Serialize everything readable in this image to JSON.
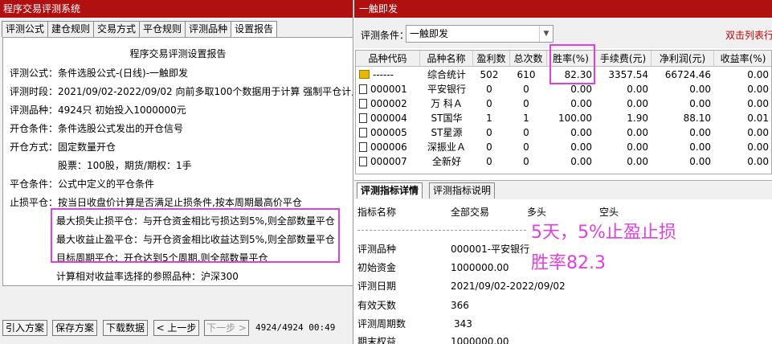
{
  "left": {
    "title": "程序交易评测系统",
    "tabs": [
      "评测公式",
      "建仓规则",
      "交易方式",
      "平仓规则",
      "评测品种",
      "设置报告"
    ],
    "report": {
      "heading": "程序交易评测设置报告",
      "lines": [
        "评测公式：条件选股公式-(日线)-一触即发",
        "评测时段：2021/09/02-2022/09/02 向前多取100个数据用于计算 强制平仓计入",
        "评测品种：4924只 初始投入1000000元",
        "开仓条件：条件选股公式发出的开仓信号",
        "开仓方式：固定数量开仓",
        "股票：100股，期货/期权：1手",
        "平仓条件：公式中定义的平仓条件",
        "止损平仓：按当日收盘价计算是否满足止损条件,按本周期最高价平仓",
        "最大损失止损平仓：与开仓资金相比亏损达到5%,则全部数量平仓",
        "最大收益止盈平仓：与开仓资金相比收益达到5%,则全部数量平仓",
        "目标周期平仓：开仓达到5个周期,则全部数量平仓",
        "计算相对收益率选择的参照品种：沪深300"
      ]
    },
    "buttons": {
      "import": "引入方案",
      "save": "保存方案",
      "download": "下载数据",
      "prev": "< 上一步",
      "next": "下一步 >"
    },
    "status": "4924/4924 00:49"
  },
  "right": {
    "title": "一触即发",
    "filter_label": "评测条件：",
    "filter_value": "一触即发",
    "dblclick_hint": "双击列表行",
    "columns": [
      "品种代码",
      "品种名称",
      "盈利数",
      "总次数",
      "胜率(%)",
      "手续费(元)",
      "净利润(元)",
      "收益率(%)"
    ],
    "rows": [
      {
        "code": "------",
        "name": "综合统计",
        "win": "502",
        "total": "610",
        "rate": "82.30",
        "fee": "3357.54",
        "profit": "66724.46",
        "ret": "0.00",
        "icon": "folder-icon"
      },
      {
        "code": "000001",
        "name": "平安银行",
        "win": "0",
        "total": "0",
        "rate": "0.00",
        "fee": "0.00",
        "profit": "0.00",
        "ret": "0.00",
        "icon": "document-icon"
      },
      {
        "code": "000002",
        "name": "万 科Ａ",
        "win": "0",
        "total": "0",
        "rate": "0.00",
        "fee": "0.00",
        "profit": "0.00",
        "ret": "0.00",
        "icon": "document-icon"
      },
      {
        "code": "000004",
        "name": "ST国华",
        "win": "1",
        "total": "1",
        "rate": "100.00",
        "fee": "1.90",
        "profit": "88.10",
        "ret": "0.01",
        "icon": "document-icon"
      },
      {
        "code": "000005",
        "name": "ST星源",
        "win": "0",
        "total": "0",
        "rate": "0.00",
        "fee": "0.00",
        "profit": "0.00",
        "ret": "0.00",
        "icon": "document-icon"
      },
      {
        "code": "000006",
        "name": "深振业Ａ",
        "win": "0",
        "total": "0",
        "rate": "0.00",
        "fee": "0.00",
        "profit": "0.00",
        "ret": "0.00",
        "icon": "document-icon"
      },
      {
        "code": "000007",
        "name": "全新好",
        "win": "0",
        "total": "0",
        "rate": "0.00",
        "fee": "0.00",
        "profit": "0.00",
        "ret": "0.00",
        "icon": "document-icon"
      }
    ],
    "tabs": [
      "评测指标详情",
      "评测指标说明"
    ],
    "detail_headers": [
      "指标名称",
      "全部交易",
      "多头",
      "空头"
    ],
    "detail_rows": [
      {
        "label": "评测品种",
        "value": "000001-平安银行"
      },
      {
        "label": "初始资金",
        "value": "1000000.00"
      },
      {
        "label": "评测日期",
        "value": "2021/09/02-2022/09/02"
      },
      {
        "label": "有效天数",
        "value": "366"
      },
      {
        "label": "评测周期数",
        "value": "343"
      },
      {
        "label": "期末权益",
        "value": "1000000.00"
      }
    ],
    "annotation_line1": "5天，5%止盈止损",
    "annotation_line2": "胜率82.3",
    "highlight_color": "#e040e0"
  }
}
